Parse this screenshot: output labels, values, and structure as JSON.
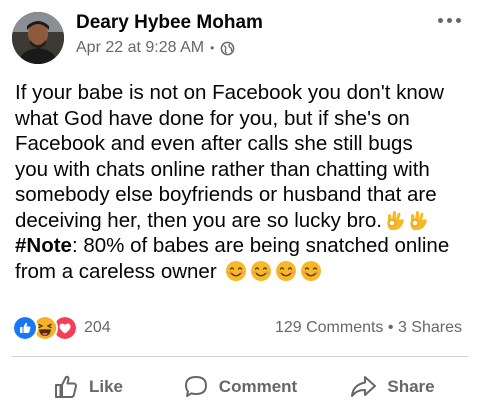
{
  "post": {
    "author": "Deary Hybee Moham",
    "date": "Apr 22 at 9:28 AM",
    "separator": "•",
    "privacy_icon": "globe-icon",
    "text_lines": [
      "If your babe is not on Facebook you don't know",
      "what  God  have  done  for  you, but  if  she's on",
      "Facebook  and even  after  calls  she  still  bugs",
      "you with chats online rather than chatting with",
      "somebody else boyfriends or husband that are",
      "deceiving her, then you are so lucky bro."
    ],
    "note_tag": "#Note",
    "note_text": ": 80% of babes are being snatched online",
    "last_line": "from a careless owner",
    "emojis": {
      "ok_hand": "ok-hand-emoji",
      "smile": "smiling-face-emoji"
    }
  },
  "stats": {
    "reaction_count": "204",
    "reaction_icons": [
      "like-reaction-icon",
      "haha-reaction-icon",
      "love-reaction-icon"
    ],
    "comments": "129 Comments",
    "separator": "•",
    "shares": "3 Shares"
  },
  "actions": {
    "like": "Like",
    "comment": "Comment",
    "share": "Share"
  },
  "colors": {
    "text": "#050505",
    "secondary": "#65676b",
    "like_blue": "#1877f2",
    "love_red": "#f33e58",
    "haha_yellow": "#f7b125"
  }
}
